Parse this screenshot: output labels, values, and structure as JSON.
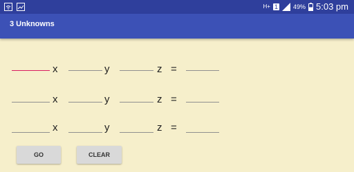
{
  "status_bar": {
    "network": "H+",
    "sim": "1",
    "battery": "49%",
    "time": "5:03 pm",
    "icons": [
      "wifi-icon",
      "image-icon",
      "signal-icon",
      "battery-icon"
    ]
  },
  "app_bar": {
    "title": "3 Unknowns"
  },
  "equations": [
    {
      "x_label": "x",
      "y_label": "y",
      "z_label": "z",
      "equals": "=",
      "x_value": "",
      "y_value": "",
      "z_value": "",
      "result_value": ""
    },
    {
      "x_label": "x",
      "y_label": "y",
      "z_label": "z",
      "equals": "=",
      "x_value": "",
      "y_value": "",
      "z_value": "",
      "result_value": ""
    },
    {
      "x_label": "x",
      "y_label": "y",
      "z_label": "z",
      "equals": "=",
      "x_value": "",
      "y_value": "",
      "z_value": "",
      "result_value": ""
    }
  ],
  "buttons": {
    "go": "GO",
    "clear": "CLEAR"
  },
  "colors": {
    "status_bar": "#2f3f9c",
    "app_bar": "#3c51b6",
    "background": "#f6efcb",
    "focus_underline": "#d81b60"
  }
}
